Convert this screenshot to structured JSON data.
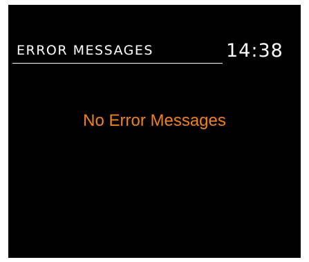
{
  "header": {
    "title": "ERROR MESSAGES",
    "time": "14:38"
  },
  "main": {
    "empty_message": "No Error Messages"
  },
  "colors": {
    "background": "#000000",
    "text": "#ffffff",
    "accent": "#f0821e"
  }
}
